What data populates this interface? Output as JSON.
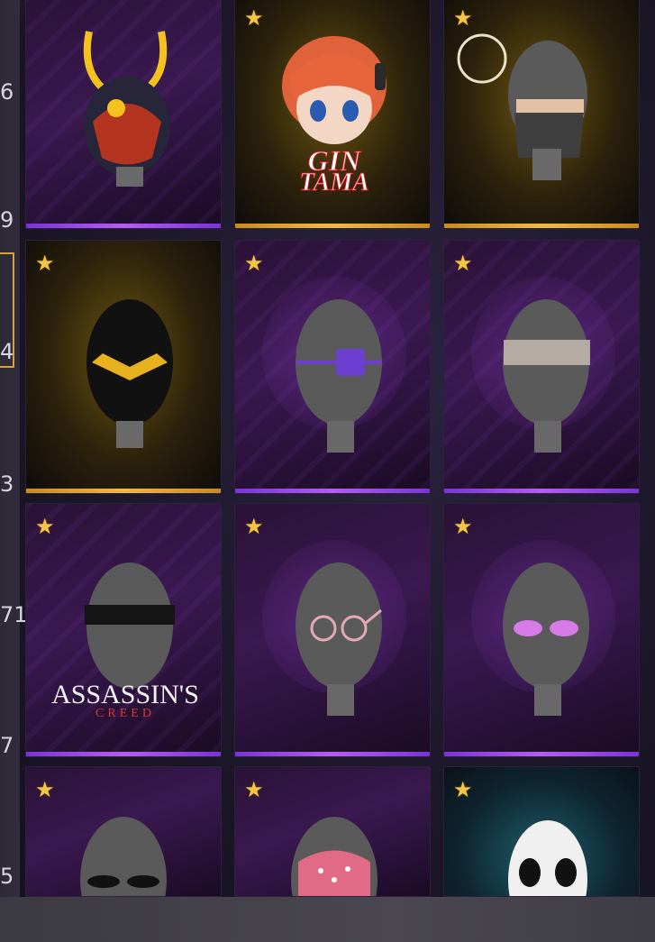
{
  "side_numbers": [
    "6",
    "9",
    "4",
    "3",
    "71",
    "7",
    "5"
  ],
  "items": [
    {
      "name": "samurai-kabuto-mask",
      "rarity": "purple",
      "star": false
    },
    {
      "name": "gintama-kagura-head",
      "rarity": "gold",
      "star": true,
      "logo": {
        "line1": "GIN",
        "line2": "TAMA"
      }
    },
    {
      "name": "ninja-face-mask",
      "rarity": "gold",
      "star": true
    },
    {
      "name": "black-gold-visor-mask",
      "rarity": "gold",
      "star": true
    },
    {
      "name": "purple-eyepatch",
      "rarity": "purple",
      "star": true
    },
    {
      "name": "lace-blindfold",
      "rarity": "purple",
      "star": true
    },
    {
      "name": "black-blindfold",
      "rarity": "purple",
      "star": true,
      "logo": {
        "line1": "ASSASSIN'S",
        "line2": "CREED"
      }
    },
    {
      "name": "round-glasses",
      "rarity": "purple",
      "star": true
    },
    {
      "name": "pink-cat-eye-glasses",
      "rarity": "purple",
      "star": true
    },
    {
      "name": "dark-sunglasses",
      "rarity": "purple",
      "star": true
    },
    {
      "name": "pink-polka-headwrap",
      "rarity": "purple",
      "star": true
    },
    {
      "name": "skull-mask",
      "rarity": "teal",
      "star": true
    }
  ],
  "star_glyph": "★"
}
